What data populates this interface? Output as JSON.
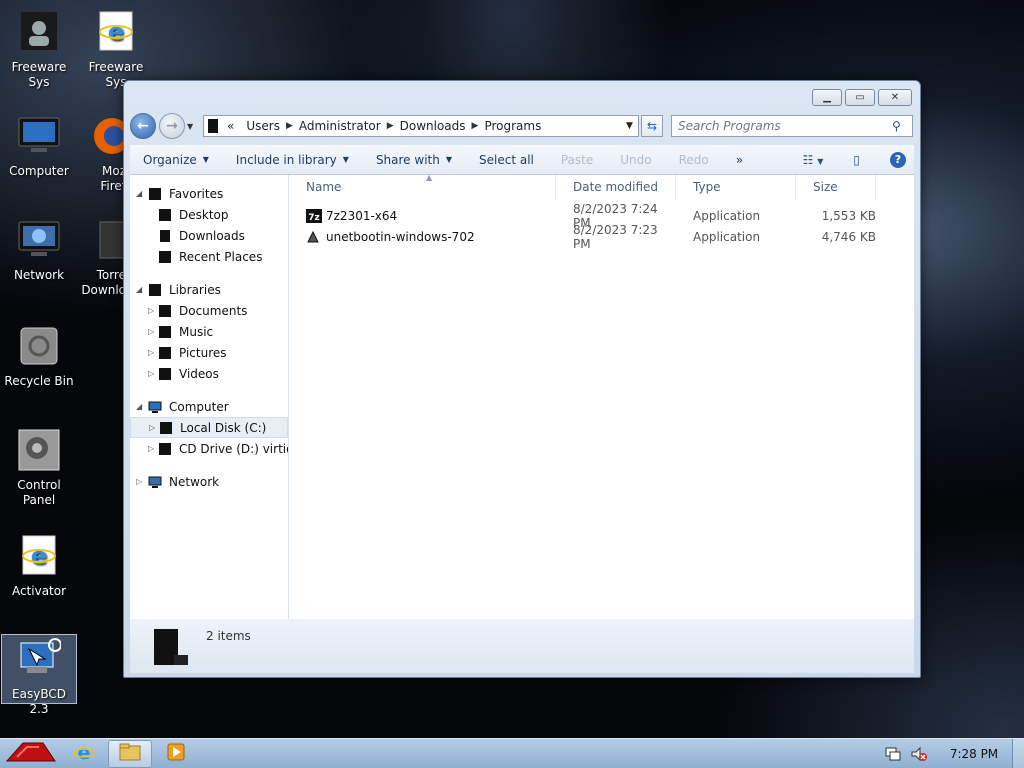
{
  "desktop": {
    "icons": [
      {
        "label": "Freeware Sys"
      },
      {
        "label": "Freeware Sys"
      },
      {
        "label": "Computer"
      },
      {
        "label": "Moz\nFiref"
      },
      {
        "label": "Network"
      },
      {
        "label": "Torre\nDownlo"
      },
      {
        "label": "Recycle Bin"
      },
      {
        "label": "Control Panel"
      },
      {
        "label": "Activator"
      },
      {
        "label": "EasyBCD 2.3"
      }
    ]
  },
  "window": {
    "address": {
      "overflow": "«",
      "crumbs": [
        "Users",
        "Administrator",
        "Downloads",
        "Programs"
      ]
    },
    "search_placeholder": "Search Programs",
    "toolbar": {
      "organize": "Organize",
      "include": "Include in library",
      "share": "Share with",
      "select_all": "Select all",
      "paste": "Paste",
      "undo": "Undo",
      "redo": "Redo",
      "more": "»"
    },
    "nav": {
      "favorites": "Favorites",
      "desktop": "Desktop",
      "downloads": "Downloads",
      "recent": "Recent Places",
      "libraries": "Libraries",
      "documents": "Documents",
      "music": "Music",
      "pictures": "Pictures",
      "videos": "Videos",
      "computer": "Computer",
      "local_disk": "Local Disk (C:)",
      "cd_drive": "CD Drive (D:) virtio-v",
      "network": "Network"
    },
    "columns": {
      "name": "Name",
      "date": "Date modified",
      "type": "Type",
      "size": "Size"
    },
    "files": [
      {
        "name": "7z2301-x64",
        "date": "8/2/2023 7:24 PM",
        "type": "Application",
        "size": "1,553 KB"
      },
      {
        "name": "unetbootin-windows-702",
        "date": "8/2/2023 7:23 PM",
        "type": "Application",
        "size": "4,746 KB"
      }
    ],
    "details": "2 items"
  },
  "taskbar": {
    "clock": "7:28 PM"
  }
}
